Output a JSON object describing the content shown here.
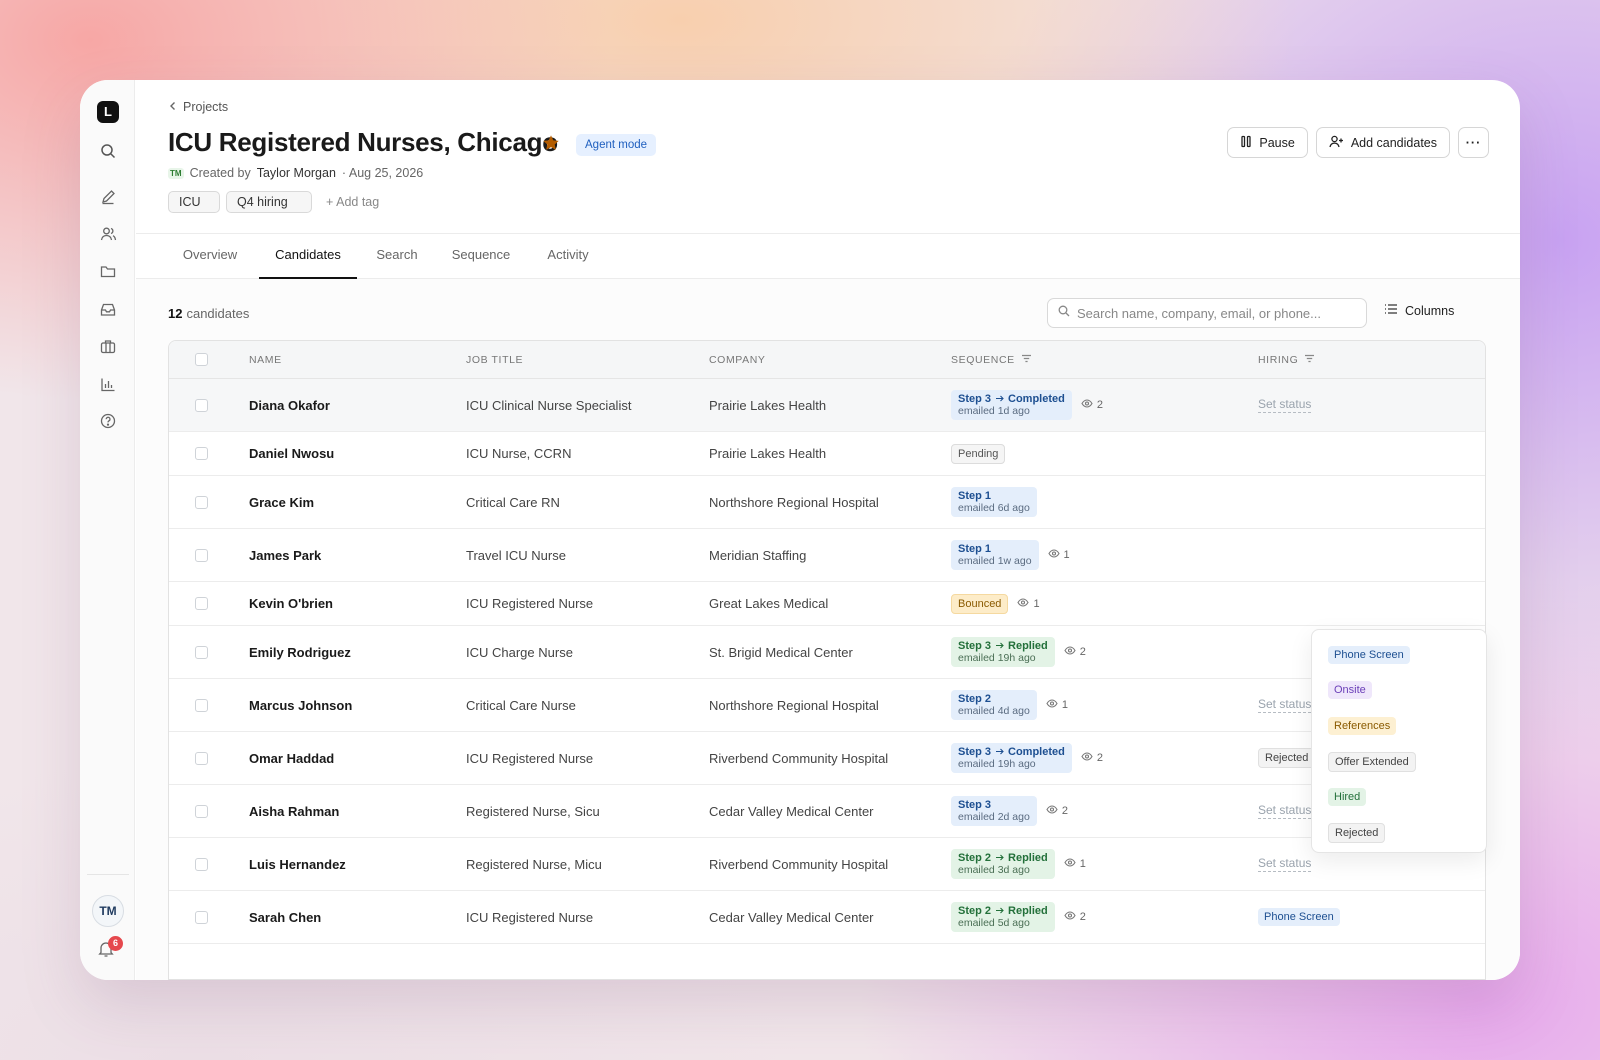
{
  "rail": {
    "logo_letter": "L",
    "icons": [
      "search-icon",
      "pencil-icon",
      "users-icon",
      "folder-icon",
      "inbox-icon",
      "briefcase-icon",
      "bar-chart-icon",
      "help-icon"
    ],
    "avatar_initials": "TM",
    "notification_count": "6"
  },
  "header": {
    "breadcrumb": "Projects",
    "title": "ICU Registered Nurses, Chicago",
    "starred": true,
    "star_color": "#b35c00",
    "mode_badge": "Agent mode",
    "creator_initials": "TM",
    "created_by_label": "Created by",
    "creator": "Taylor Morgan",
    "created_date": "· Aug 25, 2026",
    "tags": [
      "ICU",
      "Q4 hiring"
    ],
    "add_tag_label": "Add tag",
    "pause_label": "Pause",
    "add_candidates_label": "Add candidates",
    "more_label": "···"
  },
  "tabs": [
    {
      "label": "Overview"
    },
    {
      "label": "Candidates",
      "active": true
    },
    {
      "label": "Search"
    },
    {
      "label": "Sequence"
    },
    {
      "label": "Activity"
    }
  ],
  "toolbar": {
    "count": "12",
    "count_label": "candidates",
    "search_placeholder": "Search name, company, email, or phone...",
    "columns_label": "Columns"
  },
  "columns": [
    "NAME",
    "JOB TITLE",
    "COMPANY",
    "SEQUENCE",
    "HIRING"
  ],
  "rows": [
    {
      "name": "Diana Okafor",
      "title": "ICU Clinical Nurse Specialist",
      "company": "Prairie Lakes Health",
      "seq_step": "Step 3",
      "seq_status": "Completed",
      "seq_color": "blue",
      "seq_time": "emailed 1d ago",
      "views": "2",
      "hiring": "Set status",
      "hiring_type": "set"
    },
    {
      "name": "Daniel Nwosu",
      "title": "ICU Nurse, CCRN",
      "company": "Prairie Lakes Health",
      "seq_pill": "Pending",
      "seq_pill_type": "pending",
      "hiring_type": "none"
    },
    {
      "name": "Grace Kim",
      "title": "Critical Care RN",
      "company": "Northshore Regional Hospital",
      "seq_step": "Step 1",
      "seq_color": "blue",
      "seq_time": "emailed 6d ago",
      "hiring_type": "none"
    },
    {
      "name": "James Park",
      "title": "Travel ICU Nurse",
      "company": "Meridian Staffing",
      "seq_step": "Step 1",
      "seq_color": "blue",
      "seq_time": "emailed 1w ago",
      "views": "1",
      "hiring_type": "none"
    },
    {
      "name": "Kevin O'brien",
      "title": "ICU Registered Nurse",
      "company": "Great Lakes Medical",
      "seq_pill": "Bounced",
      "seq_pill_type": "bounced",
      "views": "1",
      "hiring_type": "none"
    },
    {
      "name": "Emily Rodriguez",
      "title": "ICU Charge Nurse",
      "company": "St. Brigid Medical Center",
      "seq_step": "Step 3",
      "seq_status": "Replied",
      "seq_color": "green",
      "seq_time": "emailed 19h ago",
      "views": "2",
      "hiring_type": "none"
    },
    {
      "name": "Marcus Johnson",
      "title": "Critical Care Nurse",
      "company": "Northshore Regional Hospital",
      "seq_step": "Step 2",
      "seq_color": "blue",
      "seq_time": "emailed 4d ago",
      "views": "1",
      "hiring": "Set status",
      "hiring_type": "set"
    },
    {
      "name": "Omar Haddad",
      "title": "ICU Registered Nurse",
      "company": "Riverbend Community Hospital",
      "seq_step": "Step 3",
      "seq_status": "Completed",
      "seq_color": "blue",
      "seq_time": "emailed 19h ago",
      "views": "2",
      "hiring": "Rejected",
      "hiring_type": "rej"
    },
    {
      "name": "Aisha Rahman",
      "title": "Registered Nurse, Sicu",
      "company": "Cedar Valley Medical Center",
      "seq_step": "Step 3",
      "seq_color": "blue",
      "seq_time": "emailed 2d ago",
      "views": "2",
      "hiring": "Set status",
      "hiring_type": "set"
    },
    {
      "name": "Luis Hernandez",
      "title": "Registered Nurse, Micu",
      "company": "Riverbend Community Hospital",
      "seq_step": "Step 2",
      "seq_status": "Replied",
      "seq_color": "green",
      "seq_time": "emailed 3d ago",
      "views": "1",
      "hiring": "Set status",
      "hiring_type": "set"
    },
    {
      "name": "Sarah Chen",
      "title": "ICU Registered Nurse",
      "company": "Cedar Valley Medical Center",
      "seq_step": "Step 2",
      "seq_status": "Replied",
      "seq_color": "green",
      "seq_time": "emailed 5d ago",
      "views": "2",
      "hiring": "Phone Screen",
      "hiring_type": "phone"
    }
  ],
  "status_menu": {
    "options": [
      "Phone Screen",
      "Onsite",
      "References",
      "Offer Extended",
      "Hired",
      "Rejected"
    ]
  }
}
